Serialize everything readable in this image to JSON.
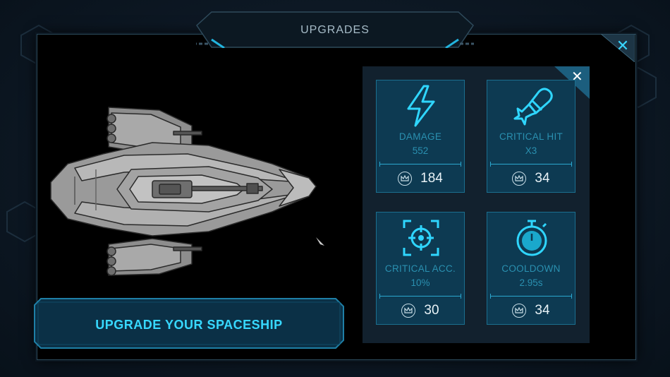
{
  "header": {
    "title": "UPGRADES"
  },
  "main_close": {
    "glyph": "✕"
  },
  "panel_close": {
    "glyph": "✕"
  },
  "banner": {
    "label": "UPGRADE YOUR SPACESHIP"
  },
  "upgrades": [
    {
      "name": "DAMAGE",
      "value": "552",
      "cost": "184",
      "icon": "lightning-icon"
    },
    {
      "name": "CRITICAL HIT",
      "value": "X3",
      "cost": "34",
      "icon": "bomb-icon"
    },
    {
      "name": "CRITICAL ACC.",
      "value": "10%",
      "cost": "30",
      "icon": "crosshair-icon"
    },
    {
      "name": "COOLDOWN",
      "value": "2.95s",
      "cost": "34",
      "icon": "stopwatch-icon"
    }
  ],
  "currency_icon": "crown-icon",
  "colors": {
    "accent": "#37d8ff",
    "card_bg": "#0d3a52",
    "panel_bg": "#12212e",
    "label_muted": "#2a90b0",
    "cost_text": "#e8f2f6"
  }
}
